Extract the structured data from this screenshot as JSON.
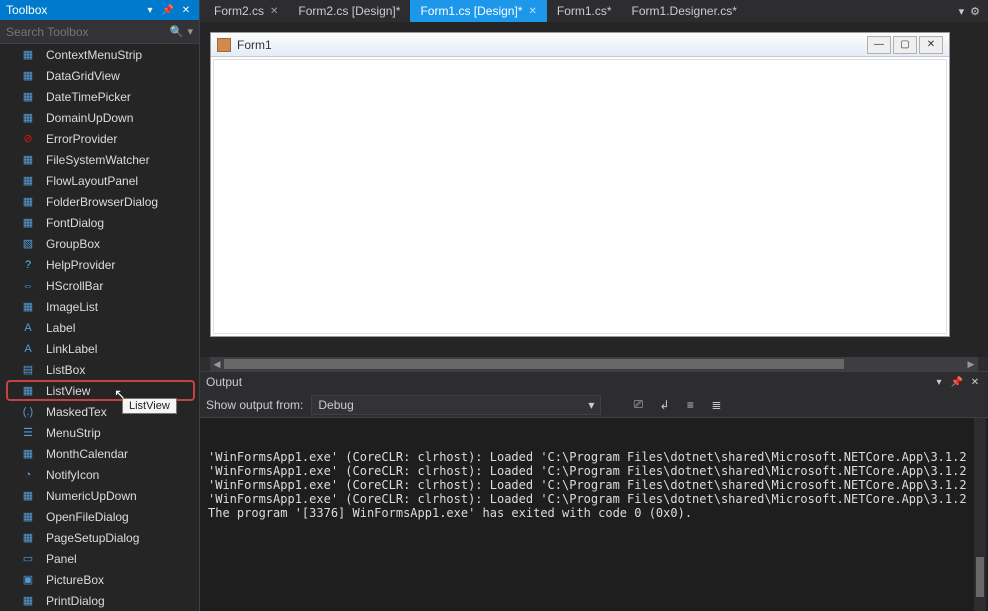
{
  "toolbox": {
    "title": "Toolbox",
    "search_placeholder": "Search Toolbox",
    "items": [
      {
        "icon": "▦",
        "label": "ContextMenuStrip"
      },
      {
        "icon": "▦",
        "label": "DataGridView"
      },
      {
        "icon": "▦",
        "label": "DateTimePicker"
      },
      {
        "icon": "▦",
        "label": "DomainUpDown"
      },
      {
        "icon": "⊘",
        "label": "ErrorProvider",
        "iconColor": "#e51400"
      },
      {
        "icon": "▦",
        "label": "FileSystemWatcher"
      },
      {
        "icon": "▦",
        "label": "FlowLayoutPanel"
      },
      {
        "icon": "▦",
        "label": "FolderBrowserDialog"
      },
      {
        "icon": "▦",
        "label": "FontDialog"
      },
      {
        "icon": "▧",
        "label": "GroupBox"
      },
      {
        "icon": "?",
        "label": "HelpProvider",
        "iconColor": "#4fc1ff"
      },
      {
        "icon": "⇔",
        "label": "HScrollBar"
      },
      {
        "icon": "▦",
        "label": "ImageList"
      },
      {
        "icon": "A",
        "label": "Label"
      },
      {
        "icon": "A",
        "label": "LinkLabel"
      },
      {
        "icon": "▤",
        "label": "ListBox"
      },
      {
        "icon": "▦",
        "label": "ListView",
        "highlight": true,
        "tooltip": "ListView"
      },
      {
        "icon": "(.)",
        "label": "MaskedTex"
      },
      {
        "icon": "☰",
        "label": "MenuStrip"
      },
      {
        "icon": "▦",
        "label": "MonthCalendar"
      },
      {
        "icon": "◔",
        "label": "NotifyIcon"
      },
      {
        "icon": "▦",
        "label": "NumericUpDown"
      },
      {
        "icon": "▦",
        "label": "OpenFileDialog"
      },
      {
        "icon": "▦",
        "label": "PageSetupDialog"
      },
      {
        "icon": "▭",
        "label": "Panel"
      },
      {
        "icon": "▣",
        "label": "PictureBox"
      },
      {
        "icon": "▦",
        "label": "PrintDialog"
      }
    ]
  },
  "tabs": [
    {
      "label": "Form2.cs",
      "close": true
    },
    {
      "label": "Form2.cs [Design]*"
    },
    {
      "label": "Form1.cs [Design]*",
      "active": true,
      "close": true
    },
    {
      "label": "Form1.cs*"
    },
    {
      "label": "Form1.Designer.cs*"
    }
  ],
  "form": {
    "title": "Form1"
  },
  "output": {
    "title": "Output",
    "show_label": "Show output from:",
    "source": "Debug",
    "lines": [
      "'WinFormsApp1.exe' (CoreCLR: clrhost): Loaded 'C:\\Program Files\\dotnet\\shared\\Microsoft.NETCore.App\\3.1.2",
      "'WinFormsApp1.exe' (CoreCLR: clrhost): Loaded 'C:\\Program Files\\dotnet\\shared\\Microsoft.NETCore.App\\3.1.2",
      "'WinFormsApp1.exe' (CoreCLR: clrhost): Loaded 'C:\\Program Files\\dotnet\\shared\\Microsoft.NETCore.App\\3.1.2",
      "'WinFormsApp1.exe' (CoreCLR: clrhost): Loaded 'C:\\Program Files\\dotnet\\shared\\Microsoft.NETCore.App\\3.1.2",
      "The program '[3376] WinFormsApp1.exe' has exited with code 0 (0x0)."
    ]
  }
}
